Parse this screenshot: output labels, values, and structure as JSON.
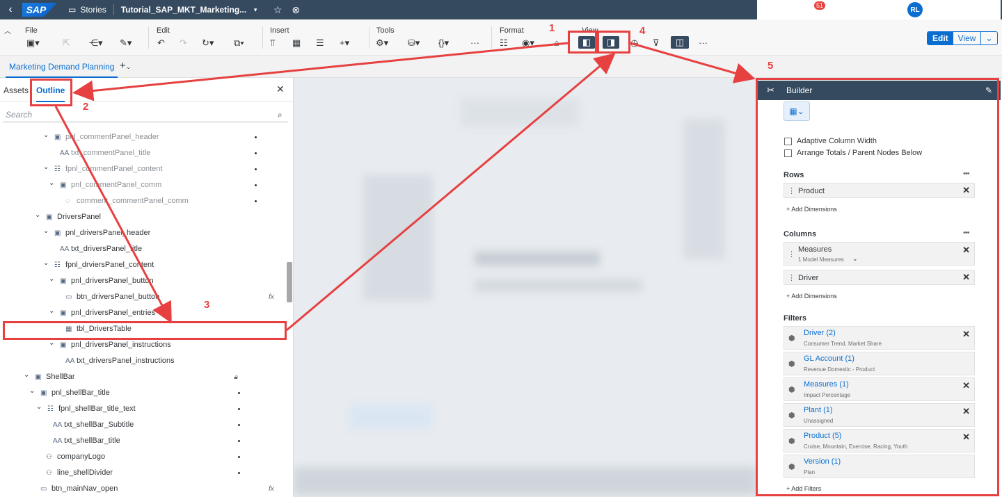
{
  "shell": {
    "stories": "Stories",
    "doc_title": "Tutorial_SAP_MKT_Marketing...",
    "notifications": "51",
    "avatar": "RL",
    "logo": "SAP"
  },
  "toolbar": {
    "groups": [
      "File",
      "Edit",
      "Insert",
      "Tools",
      "Format",
      "View"
    ],
    "edit": "Edit",
    "view": "View"
  },
  "page_tab": "Marketing Demand Planning",
  "left_panel": {
    "tab_assets": "Assets",
    "tab_outline": "Outline",
    "search_placeholder": "Search",
    "tree": [
      {
        "label": "pnl_commentPanel_header"
      },
      {
        "label": "txt_commentPanel_title"
      },
      {
        "label": "fpnl_commentPanel_content"
      },
      {
        "label": "pnl_commentPanel_comm"
      },
      {
        "label": "comment_commentPanel_comm"
      },
      {
        "label": "DriversPanel"
      },
      {
        "label": "pnl_driversPanel_header"
      },
      {
        "label": "txt_driversPanel_title"
      },
      {
        "label": "fpnl_drviersPanel_content"
      },
      {
        "label": "pnl_driversPanel_button"
      },
      {
        "label": "btn_driversPanel_button"
      },
      {
        "label": "pnl_driversPanel_entries"
      },
      {
        "label": "tbl_DriversTable"
      },
      {
        "label": "pnl_driversPanel_instructions"
      },
      {
        "label": "txt_driversPanel_instructions"
      },
      {
        "label": "ShellBar"
      },
      {
        "label": "pnl_shellBar_title"
      },
      {
        "label": "fpnl_shellBar_title_text"
      },
      {
        "label": "txt_shellBar_Subtitle"
      },
      {
        "label": "txt_shellBar_title"
      },
      {
        "label": "companyLogo"
      },
      {
        "label": "line_shellDivider"
      },
      {
        "label": "btn_mainNav_open"
      }
    ],
    "fx": "fx"
  },
  "builder": {
    "title": "Builder",
    "adaptive": "Adaptive Column Width",
    "arrange": "Arrange Totals / Parent Nodes Below",
    "rows_label": "Rows",
    "rows": [
      "Product"
    ],
    "add_dimensions": "+ Add Dimensions",
    "columns_label": "Columns",
    "columns": [
      {
        "name": "Measures",
        "sub": "1 Model Measures"
      },
      {
        "name": "Driver"
      }
    ],
    "filters_label": "Filters",
    "filters": [
      {
        "name": "Driver (2)",
        "sub": "Consumer Trend, Market Share"
      },
      {
        "name": "GL Account (1)",
        "sub": "Revenue Domestic - Product"
      },
      {
        "name": "Measures (1)",
        "sub": "Impact Percentage"
      },
      {
        "name": "Plant (1)",
        "sub": "Unassigned"
      },
      {
        "name": "Product (5)",
        "sub": "Cruise, Mountain, Exercise, Racing, Youth"
      },
      {
        "name": "Version (1)",
        "sub": "Plan"
      }
    ],
    "add_filters": "+ Add Filters"
  },
  "annotations": [
    "1",
    "2",
    "3",
    "4",
    "5"
  ]
}
